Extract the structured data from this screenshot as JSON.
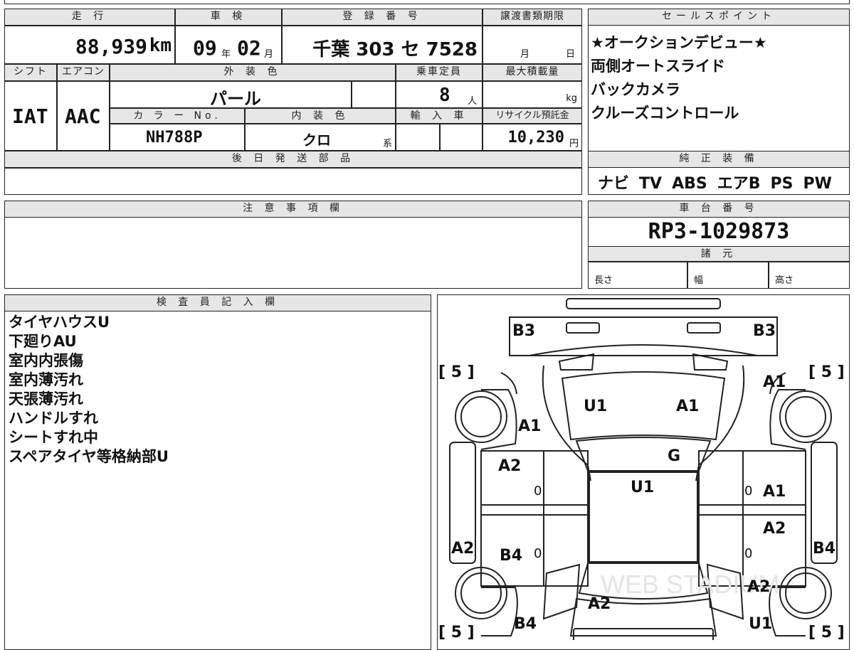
{
  "top": {
    "mileage_label": "走 行",
    "inspection_label": "車 検",
    "registration_label": "登 録 番 号",
    "transfer_label": "譲渡書類期限",
    "mileage_value": "88,939",
    "mileage_unit": "km",
    "inspection_year": "09",
    "year_unit": "年",
    "inspection_month": "02",
    "month_unit": "月",
    "registration_value": "千葉 303 セ 7528",
    "transfer_month_unit": "月",
    "transfer_day_unit": "日"
  },
  "specs": {
    "shift_label": "シフト",
    "ac_label": "エアコン",
    "exterior_label": "外 装 色",
    "capacity_label": "乗車定員",
    "max_load_label": "最大積載量",
    "shift_value": "IAT",
    "ac_value": "AAC",
    "exterior_value": "パール",
    "capacity_value": "8",
    "capacity_unit": "人",
    "max_load_unit": "kg",
    "color_no_label": "カ ラ ー No.",
    "interior_label": "内 装 色",
    "import_label": "輸 入 車",
    "recycle_label": "リサイクル預託金",
    "color_no_value": "NH788P",
    "interior_value": "クロ",
    "interior_suffix": "系",
    "recycle_value": "10,230",
    "recycle_unit": "円",
    "later_parts_label": "後 日 発 送 部 品"
  },
  "sales_points": {
    "label": "セールスポイント",
    "items": [
      "★オークションデビュー★",
      "両側オートスライド",
      "バックカメラ",
      "クルーズコントロール"
    ]
  },
  "equipment": {
    "label": "純 正 装 備",
    "items": [
      "ナビ",
      "TV",
      "ABS",
      "エアB",
      "PS",
      "PW"
    ]
  },
  "notes": {
    "label": "注 意 事 項 欄"
  },
  "chassis": {
    "label": "車 台 番 号",
    "value": "RP3-1029873",
    "dims_label": "諸 元",
    "length_label": "長さ",
    "width_label": "幅",
    "height_label": "高さ"
  },
  "inspector": {
    "label": "検 査 員 記 入 欄",
    "lines": [
      "タイヤハウスU",
      "下廻りAU",
      "室内内張傷",
      "室内薄汚れ",
      "天張薄汚れ",
      "ハンドルすれ",
      "シートすれ中",
      "スペアタイヤ等格納部U"
    ]
  },
  "diagram": {
    "tire_front_left": "[ 5 ]",
    "tire_front_right": "[ 5 ]",
    "tire_rear_left": "[ 5 ]",
    "tire_rear_right": "[ 5 ]",
    "marks": {
      "b3_left": "B3",
      "b3_right": "B3",
      "a1_right_fender": "A1",
      "u1_windshield": "U1",
      "a1_windshield": "A1",
      "a1_left_fender": "A1",
      "g_windshield": "G",
      "a2_left_front_door": "A2",
      "zero_left_front": "0",
      "u1_roof": "U1",
      "zero_right_front": "0",
      "a1_right_front_door": "A1",
      "a2_right_rear_door": "A2",
      "a2_left_side": "A2",
      "b4_left_rear_door": "B4",
      "zero_left_rear": "0",
      "zero_right_rear": "0",
      "b4_right_side": "B4",
      "a2_right_quarter": "A2",
      "a2_rear_glass": "A2",
      "b4_left_quarter": "B4",
      "u1_right_quarter": "U1"
    },
    "watermark": "WEB STADIUM"
  }
}
